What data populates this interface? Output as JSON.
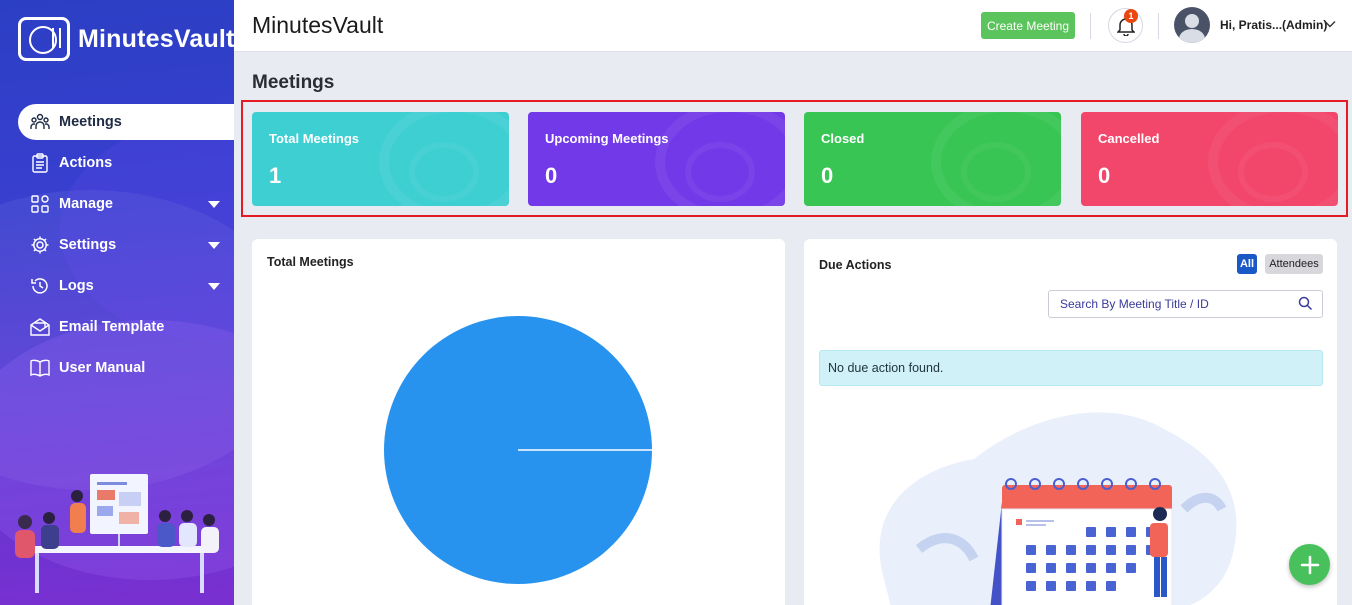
{
  "app": {
    "logo_text": "MinutesVault",
    "title": "MinutesVault"
  },
  "sidebar": {
    "items": [
      {
        "label": "Meetings",
        "icon": "meetings-icon",
        "active": true
      },
      {
        "label": "Actions",
        "icon": "clipboard-icon"
      },
      {
        "label": "Manage",
        "icon": "grid-icon",
        "has_caret": true
      },
      {
        "label": "Settings",
        "icon": "gear-icon",
        "has_caret": true
      },
      {
        "label": "Logs",
        "icon": "history-icon",
        "has_caret": true
      },
      {
        "label": "Email Template",
        "icon": "envelope-icon"
      },
      {
        "label": "User Manual",
        "icon": "book-icon"
      }
    ]
  },
  "header": {
    "create_button": "Create Meeting",
    "notification_count": "1",
    "user_greeting": "Hi, Pratis...(Admin)"
  },
  "page": {
    "title": "Meetings"
  },
  "stats": [
    {
      "label": "Total Meetings",
      "value": "1",
      "color": "#3ecfd3"
    },
    {
      "label": "Upcoming Meetings",
      "value": "0",
      "color": "#7239e8"
    },
    {
      "label": "Closed",
      "value": "0",
      "color": "#38c553"
    },
    {
      "label": "Cancelled",
      "value": "0",
      "color": "#f2466b"
    }
  ],
  "total_meetings_card": {
    "title": "Total Meetings"
  },
  "chart_data": {
    "type": "pie",
    "slices": [
      {
        "label": "",
        "value": 1,
        "color": "#2893ee"
      }
    ]
  },
  "due_actions": {
    "title": "Due Actions",
    "filter_all": "All",
    "filter_attendees": "Attendees",
    "search_placeholder": "Search By Meeting Title / ID",
    "empty_message": "No due action found."
  },
  "colors": {
    "accent": "#1b58c7",
    "create_button": "#5cc45d",
    "fab": "#48c05c",
    "highlight_border": "#e51b23"
  }
}
